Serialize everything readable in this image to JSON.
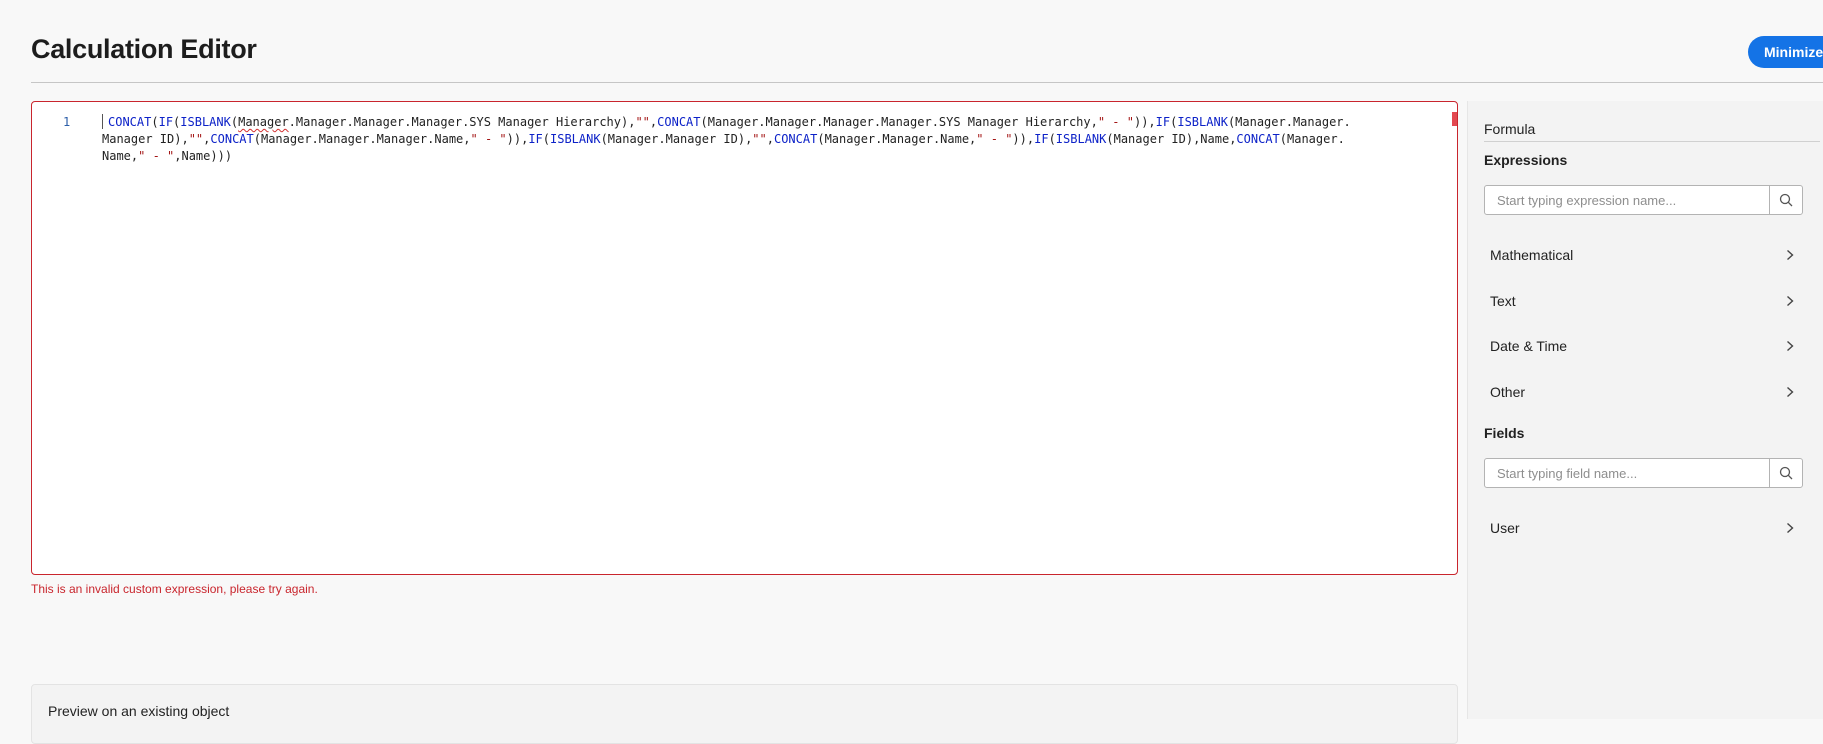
{
  "header": {
    "title": "Calculation Editor",
    "minimize_label": "Minimize"
  },
  "editor": {
    "line_number": "1",
    "code_tokens": [
      [
        {
          "t": "CONCAT",
          "c": "kw"
        },
        {
          "t": "("
        },
        {
          "t": "IF",
          "c": "kw"
        },
        {
          "t": "("
        },
        {
          "t": "ISBLANK",
          "c": "kw"
        },
        {
          "t": "("
        },
        {
          "t": "Manager",
          "c": "squiggle"
        },
        {
          "t": ".Manager.Manager.Manager.SYS Manager Hierarchy),"
        },
        {
          "t": "\"\"",
          "c": "str"
        },
        {
          "t": ","
        },
        {
          "t": "CONCAT",
          "c": "kw"
        },
        {
          "t": "(Manager.Manager.Manager.Manager.SYS Manager Hierarchy,"
        },
        {
          "t": "\" - \"",
          "c": "str"
        },
        {
          "t": ")),"
        },
        {
          "t": "IF",
          "c": "kw"
        },
        {
          "t": "("
        },
        {
          "t": "ISBLANK",
          "c": "kw"
        },
        {
          "t": "(Manager.Manager."
        }
      ],
      [
        {
          "t": "Manager ID),"
        },
        {
          "t": "\"\"",
          "c": "str"
        },
        {
          "t": ","
        },
        {
          "t": "CONCAT",
          "c": "kw"
        },
        {
          "t": "(Manager.Manager.Manager.Name,"
        },
        {
          "t": "\" - \"",
          "c": "str"
        },
        {
          "t": ")),"
        },
        {
          "t": "IF",
          "c": "kw"
        },
        {
          "t": "("
        },
        {
          "t": "ISBLANK",
          "c": "kw"
        },
        {
          "t": "(Manager.Manager ID),"
        },
        {
          "t": "\"\"",
          "c": "str"
        },
        {
          "t": ","
        },
        {
          "t": "CONCAT",
          "c": "kw"
        },
        {
          "t": "(Manager.Manager.Name,"
        },
        {
          "t": "\" - \"",
          "c": "str"
        },
        {
          "t": ")),"
        },
        {
          "t": "IF",
          "c": "kw"
        },
        {
          "t": "("
        },
        {
          "t": "ISBLANK",
          "c": "kw"
        },
        {
          "t": "(Manager ID),Name,"
        },
        {
          "t": "CONCAT",
          "c": "kw"
        },
        {
          "t": "(Manager."
        }
      ],
      [
        {
          "t": "Name,"
        },
        {
          "t": "\" - \"",
          "c": "str"
        },
        {
          "t": ",Name)))"
        }
      ]
    ],
    "error_message": "This is an invalid custom expression, please try again."
  },
  "preview": {
    "title": "Preview on an existing object"
  },
  "sidebar": {
    "tab_label": "Formula",
    "expressions_heading": "Expressions",
    "expressions_placeholder": "Start typing expression name...",
    "expression_categories": [
      "Mathematical",
      "Text",
      "Date & Time",
      "Other"
    ],
    "fields_heading": "Fields",
    "fields_placeholder": "Start typing field name...",
    "field_categories": [
      "User"
    ]
  },
  "icons": {
    "search": "search-icon",
    "chevron": "chevron-right-icon"
  },
  "colors": {
    "accent": "#1473e6",
    "error": "#c9252d",
    "keyword": "#0d22c8",
    "string": "#a31515"
  }
}
